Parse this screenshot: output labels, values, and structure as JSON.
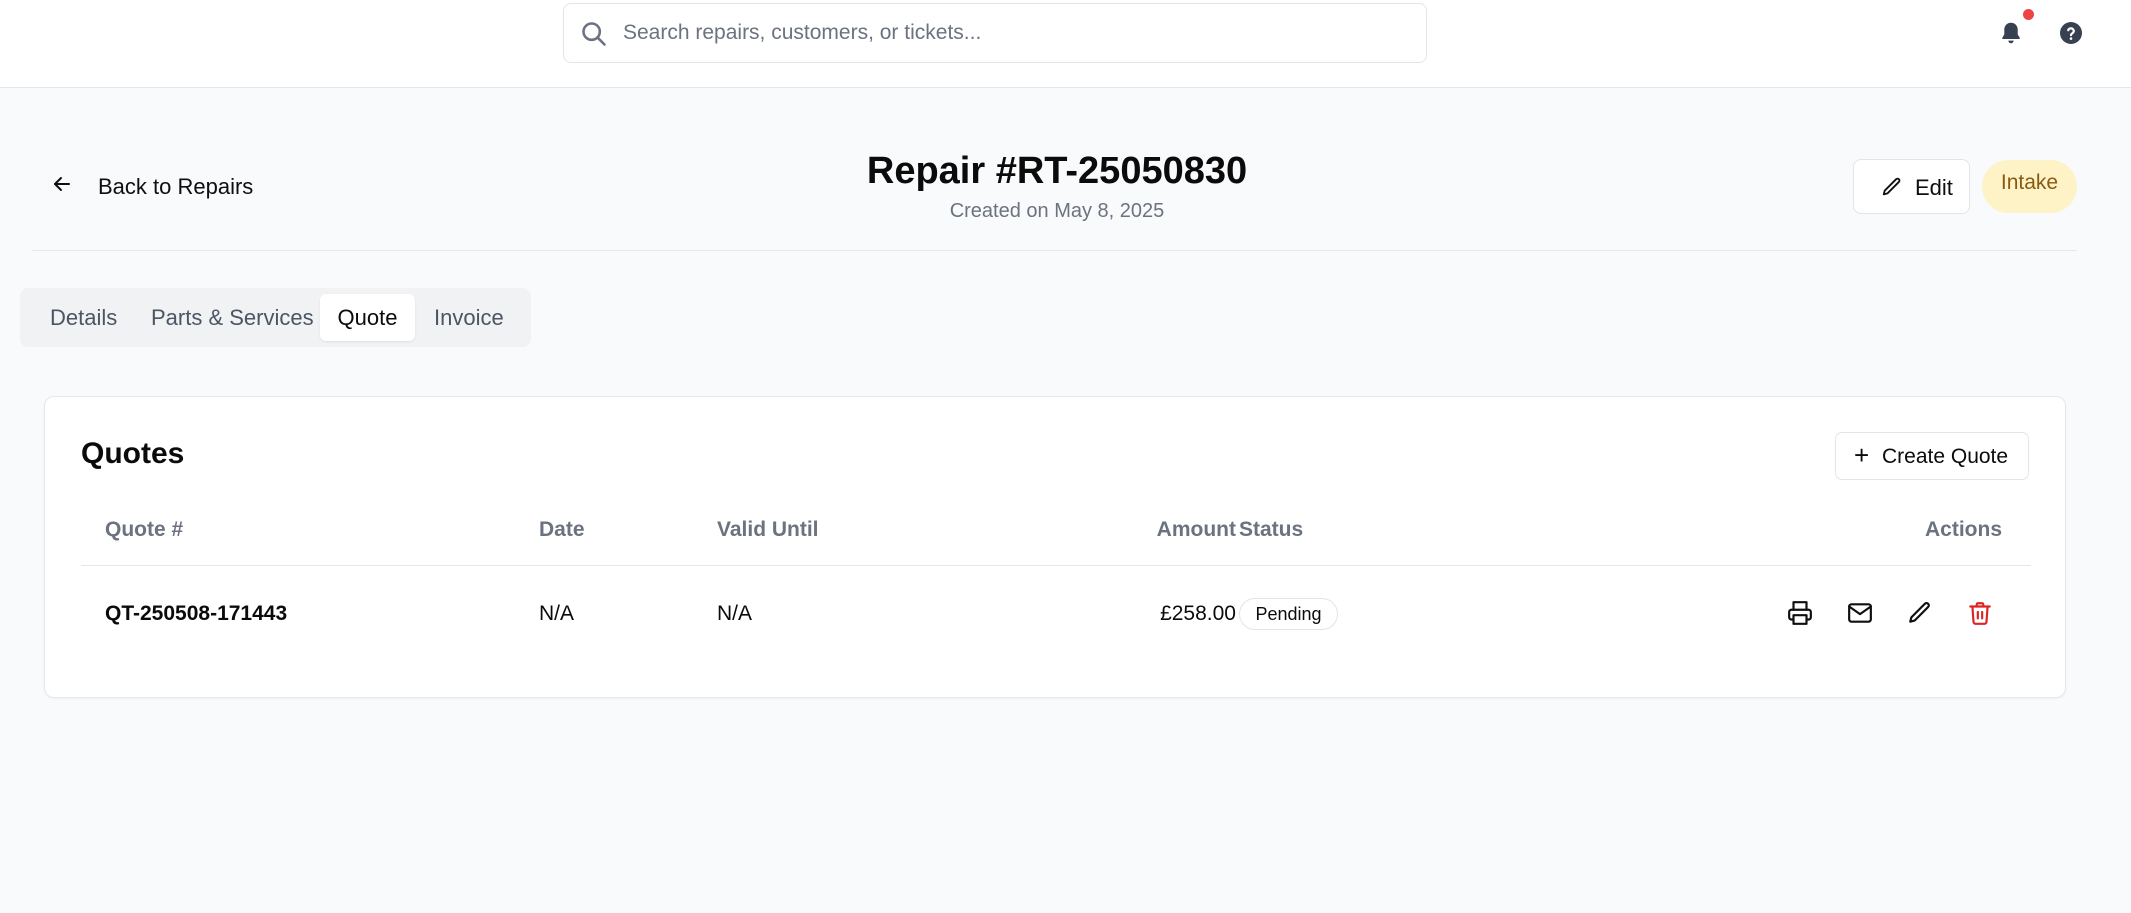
{
  "search": {
    "placeholder": "Search repairs, customers, or tickets..."
  },
  "header": {
    "back_label": "Back to Repairs",
    "title": "Repair #RT-25050830",
    "subtitle": "Created on May 8, 2025",
    "edit_label": "Edit",
    "status_badge": "Intake"
  },
  "tabs": [
    {
      "label": "Details",
      "active": false
    },
    {
      "label": "Parts & Services",
      "active": false
    },
    {
      "label": "Quote",
      "active": true
    },
    {
      "label": "Invoice",
      "active": false
    }
  ],
  "quotes": {
    "title": "Quotes",
    "create_label": "Create Quote",
    "columns": [
      "Quote #",
      "Date",
      "Valid Until",
      "Amount",
      "Status",
      "Actions"
    ],
    "rows": [
      {
        "quote_no": "QT-250508-171443",
        "date": "N/A",
        "valid_until": "N/A",
        "amount": "£258.00",
        "status": "Pending"
      }
    ]
  },
  "icons": {
    "search": "search-icon",
    "bell": "bell-icon",
    "help": "help-circle-icon",
    "back": "arrow-left-icon",
    "edit": "pencil-icon",
    "print": "printer-icon",
    "email": "mail-icon",
    "delete": "trash-icon"
  },
  "colors": {
    "notification_dot": "#ef4444",
    "badge_bg": "#fef3c7",
    "badge_text": "#8a5a12",
    "danger": "#dc2626"
  }
}
